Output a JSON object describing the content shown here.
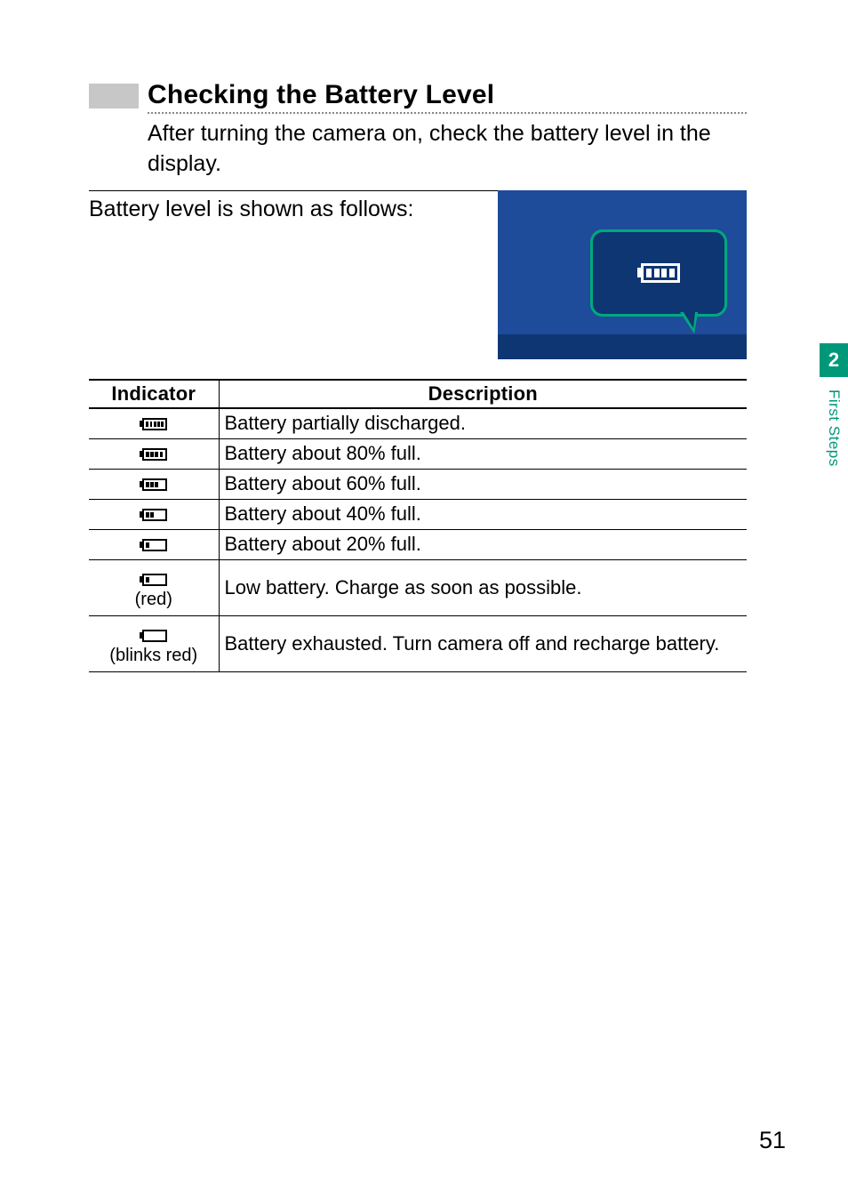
{
  "heading": "Checking the Battery Level",
  "intro": "After turning the camera on, check the battery level in the display.",
  "follow_on": "Battery level is shown as follows:",
  "table": {
    "headers": {
      "indicator": "Indicator",
      "description": "Description"
    },
    "rows": [
      {
        "bars": 5,
        "sub": "",
        "desc": "Battery partially discharged."
      },
      {
        "bars": 4,
        "sub": "",
        "desc": "Battery about 80% full."
      },
      {
        "bars": 3,
        "sub": "",
        "desc": "Battery about 60% full."
      },
      {
        "bars": 2,
        "sub": "",
        "desc": "Battery about 40% full."
      },
      {
        "bars": 1,
        "sub": "",
        "desc": "Battery about 20% full."
      },
      {
        "bars": 1,
        "sub": "(red)",
        "desc": "Low battery.  Charge as soon as possible."
      },
      {
        "bars": 0,
        "sub": "(blinks red)",
        "desc": "Battery exhausted.  Turn camera off and recharge battery."
      }
    ]
  },
  "side": {
    "chapter": "2",
    "label": "First Steps"
  },
  "page_number": "51",
  "illustration_battery_bars": 4
}
